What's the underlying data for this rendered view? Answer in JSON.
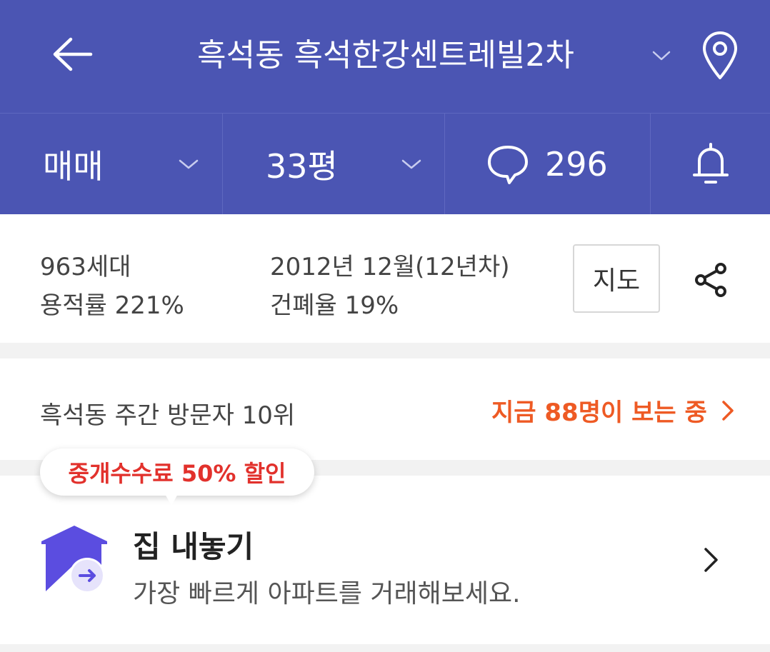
{
  "header": {
    "title": "흑석동 흑석한강센트레빌2차",
    "icons": {
      "back": "arrow-left-icon",
      "dropdown": "chevron-down-icon",
      "location": "location-pin-icon"
    }
  },
  "tabs": {
    "trade_type": "매매",
    "area": "33평",
    "comment_count": "296",
    "icons": {
      "comment": "speech-bubble-icon",
      "alarm": "bell-icon"
    }
  },
  "info": {
    "households": "963세대",
    "floor_area_ratio": "용적률 221%",
    "built": "2012년 12월(12년차)",
    "coverage_ratio": "건폐율 19%",
    "map_button": "지도",
    "share_icon": "share-icon"
  },
  "rank": {
    "text": "흑석동 주간 방문자 10위",
    "viewers_link": "지금 88명이 보는 중",
    "accent_color": "#ee5a24"
  },
  "promo": {
    "label": "중개수수료 50% 할인",
    "color": "#e2312c"
  },
  "sell": {
    "title": "집 내놓기",
    "subtitle": "가장 빠르게 아파트를 거래해보세요.",
    "icon": "house-arrow-icon",
    "chevron": "chevron-right-icon"
  },
  "colors": {
    "brand": "#4b55b3",
    "house_icon": "#5b4de0"
  }
}
